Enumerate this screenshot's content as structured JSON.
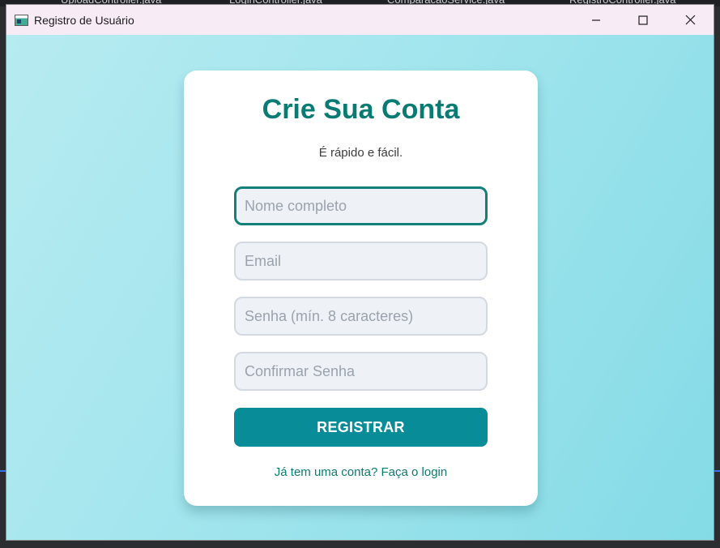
{
  "background_ide": {
    "tabs": [
      "UploadController.java",
      "LoginController.java",
      "ComparacaoService.java",
      "RegistroController.java"
    ]
  },
  "window": {
    "title": "Registro de Usuário",
    "controls": {
      "minimize": "minimize-icon",
      "maximize": "maximize-icon",
      "close": "close-icon"
    }
  },
  "colors": {
    "background_gradient": [
      "#b6ebf0",
      "#84dbe6"
    ],
    "title": "#097b73",
    "button": "#088c97",
    "link": "#0c7a72",
    "focus_border": "#13807a"
  },
  "form": {
    "title": "Crie Sua Conta",
    "subtitle": "É rápido e fácil.",
    "fields": {
      "name_placeholder": "Nome completo",
      "email_placeholder": "Email",
      "password_placeholder": "Senha (mín. 8 caracteres)",
      "confirm_placeholder": "Confirmar Senha"
    },
    "submit_label": "REGISTRAR",
    "login_link": "Já tem uma conta? Faça o login"
  }
}
